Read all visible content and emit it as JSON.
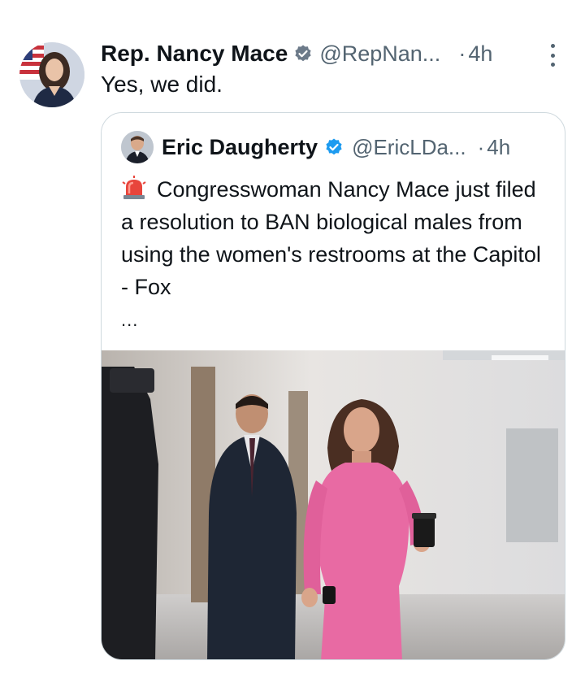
{
  "tweet": {
    "author_name": "Rep. Nancy Mace",
    "author_handle": "@RepNan...",
    "dot": "·",
    "time": "4h",
    "text": "Yes, we did."
  },
  "quote": {
    "author_name": "Eric Daugherty",
    "author_handle": "@EricLDa...",
    "dot": "·",
    "time": "4h",
    "siren_icon": "police-siren-emoji",
    "text": "Congresswoman Nancy Mace just filed a resolution to BAN biological males from using the women's restrooms at the Capitol - Fox",
    "ellipsis": "...",
    "image_alt": "Woman in pink dress walking through a hallway with a coffee cup"
  },
  "colors": {
    "verified_badge": "#1d9bf0",
    "secondary_text": "#536471",
    "border": "#cfd9de",
    "dress_pink": "#e86aa3"
  }
}
